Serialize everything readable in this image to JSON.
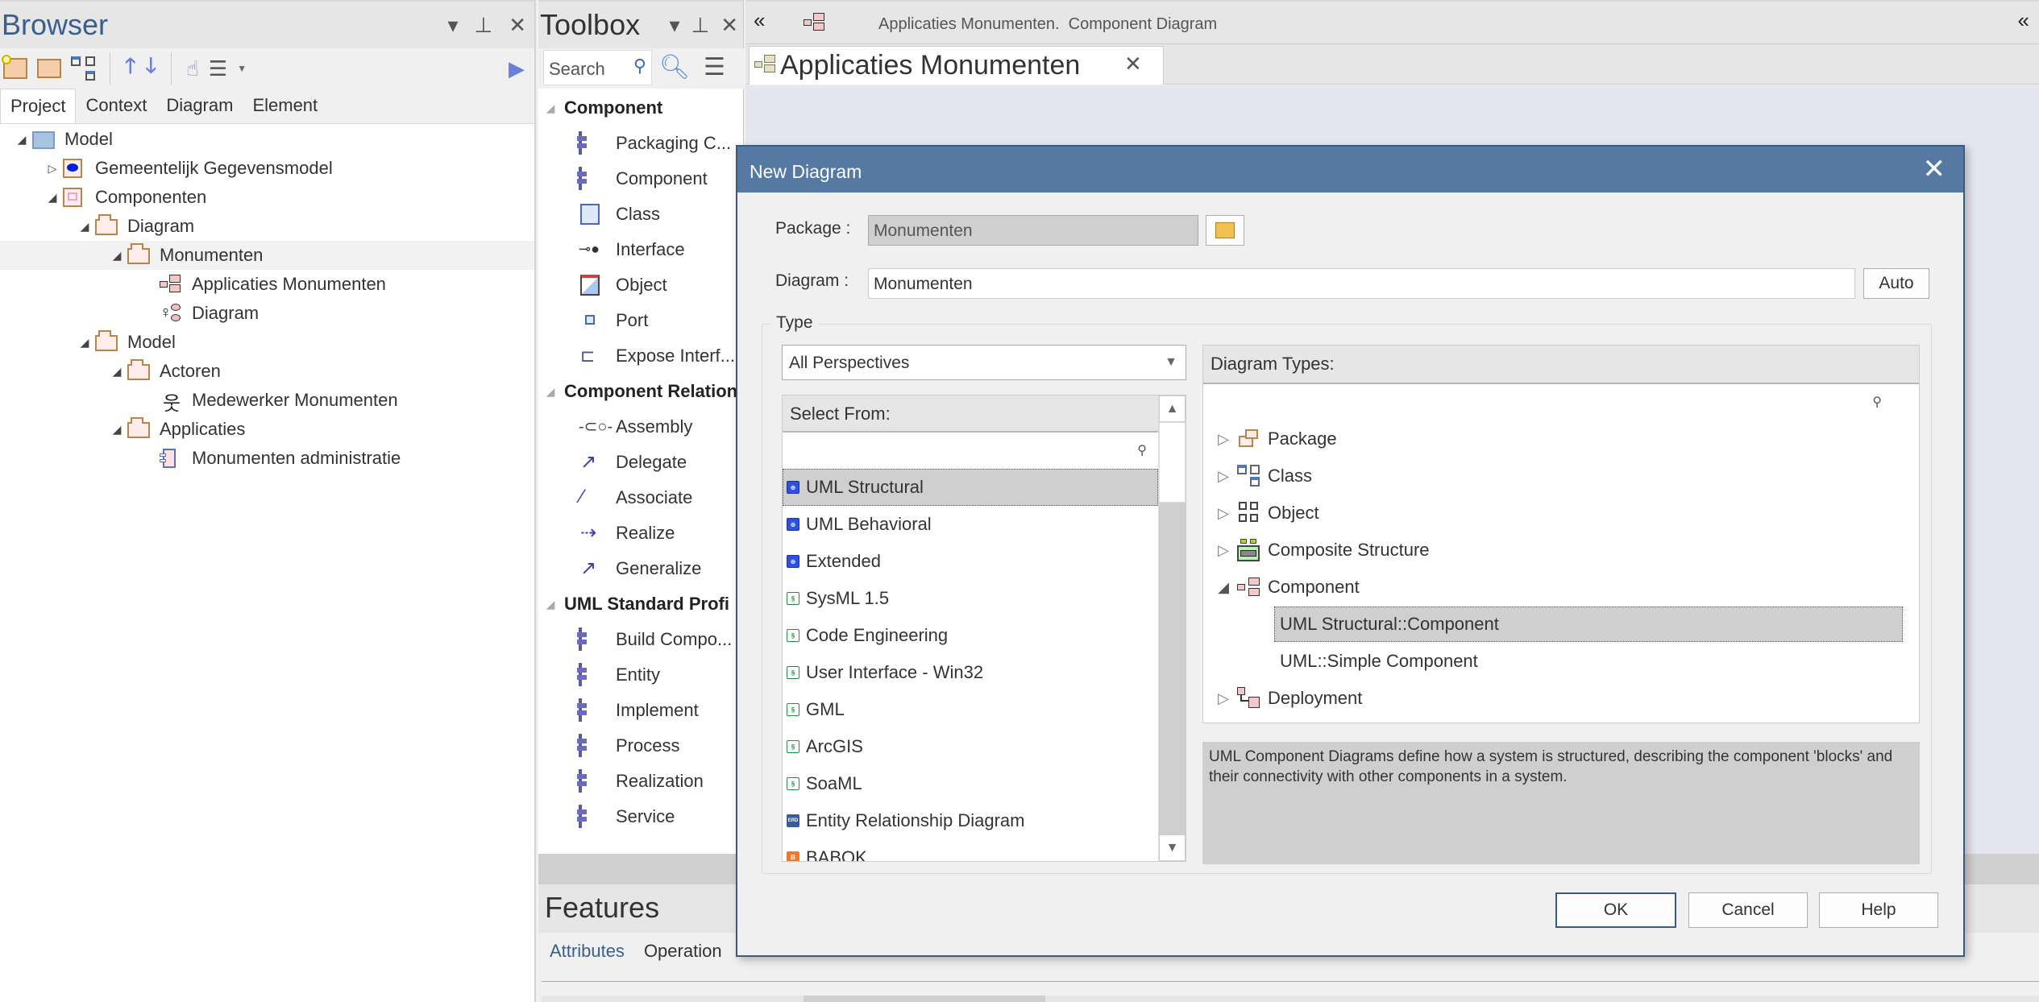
{
  "browser": {
    "title": "Browser",
    "tabs": [
      "Project",
      "Context",
      "Diagram",
      "Element"
    ],
    "active_tab": "Project",
    "tree": [
      {
        "label": "Model",
        "level": 0,
        "expanded": true,
        "icon": "model-root-icon"
      },
      {
        "label": "Gemeentelijk Gegevensmodel",
        "level": 1,
        "expanded": false,
        "icon": "package-blue-icon"
      },
      {
        "label": "Componenten",
        "level": 1,
        "expanded": true,
        "icon": "package-pink-icon"
      },
      {
        "label": "Diagram",
        "level": 2,
        "expanded": true,
        "icon": "folder-icon"
      },
      {
        "label": "Monumenten",
        "level": 3,
        "expanded": true,
        "icon": "folder-icon",
        "selected": true
      },
      {
        "label": "Applicaties Monumenten",
        "level": 4,
        "icon": "component-diagram-icon"
      },
      {
        "label": "Diagram",
        "level": 4,
        "icon": "use-case-diagram-icon"
      },
      {
        "label": "Model",
        "level": 2,
        "expanded": true,
        "icon": "folder-icon"
      },
      {
        "label": "Actoren",
        "level": 3,
        "expanded": true,
        "icon": "folder-icon"
      },
      {
        "label": "Medewerker Monumenten",
        "level": 4,
        "icon": "actor-icon"
      },
      {
        "label": "Applicaties",
        "level": 3,
        "expanded": true,
        "icon": "folder-icon"
      },
      {
        "label": "Monumenten administratie",
        "level": 4,
        "icon": "component-icon"
      }
    ]
  },
  "toolbox": {
    "title": "Toolbox",
    "search_placeholder": "Search",
    "sections": [
      {
        "title": "Component",
        "items": [
          "Packaging C...",
          "Component",
          "Class",
          "Interface",
          "Object",
          "Port",
          "Expose Interf..."
        ]
      },
      {
        "title": "Component Relation",
        "items": [
          "Assembly",
          "Delegate",
          "Associate",
          "Realize",
          "Generalize"
        ]
      },
      {
        "title": "UML Standard Profi",
        "items": [
          "Build Compo...",
          "Entity",
          "Implement",
          "Process",
          "Realization",
          "Service"
        ]
      }
    ]
  },
  "features": {
    "title": "Features",
    "tabs": [
      "Attributes",
      "Operation"
    ],
    "active_tab": "Attributes"
  },
  "diagram": {
    "breadcrumb": "Applicaties Monumenten.  Component Diagram",
    "tab_label": "Applicaties Monumenten"
  },
  "dialog": {
    "title": "New Diagram",
    "package_label": "Package :",
    "package_value": "Monumenten",
    "diagram_label": "Diagram :",
    "diagram_value": "Monumenten",
    "auto_label": "Auto",
    "type_legend": "Type",
    "perspective": "All Perspectives",
    "select_from_header": "Select From:",
    "select_from_items": [
      {
        "label": "UML Structural",
        "icon": "uml-icon",
        "selected": true
      },
      {
        "label": "UML Behavioral",
        "icon": "uml-icon"
      },
      {
        "label": "Extended",
        "icon": "uml-icon"
      },
      {
        "label": "SysML 1.5",
        "icon": "mdg-icon"
      },
      {
        "label": "Code Engineering",
        "icon": "mdg-icon"
      },
      {
        "label": "User Interface - Win32",
        "icon": "mdg-icon"
      },
      {
        "label": "GML",
        "icon": "mdg-icon"
      },
      {
        "label": "ArcGIS",
        "icon": "mdg-icon"
      },
      {
        "label": "SoaML",
        "icon": "mdg-icon"
      },
      {
        "label": "Entity Relationship Diagram",
        "icon": "erd-icon"
      },
      {
        "label": "BABOK",
        "icon": "babok-icon"
      }
    ],
    "diagram_types_header": "Diagram Types:",
    "diagram_types": [
      {
        "label": "Package",
        "expanded": false
      },
      {
        "label": "Class",
        "expanded": false
      },
      {
        "label": "Object",
        "expanded": false
      },
      {
        "label": "Composite Structure",
        "expanded": false
      },
      {
        "label": "Component",
        "expanded": true,
        "children": [
          {
            "label": "UML Structural::Component",
            "selected": true
          },
          {
            "label": "UML::Simple Component"
          }
        ]
      },
      {
        "label": "Deployment",
        "expanded": false
      }
    ],
    "description": "UML Component Diagrams define how a system is structured, describing the component 'blocks' and their connectivity with other components in a system.",
    "ok_label": "OK",
    "cancel_label": "Cancel",
    "help_label": "Help"
  }
}
